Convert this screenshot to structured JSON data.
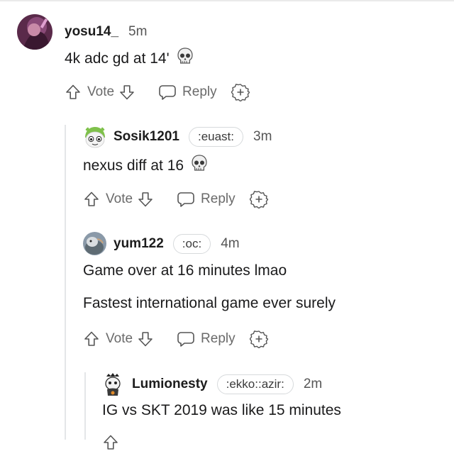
{
  "comments": [
    {
      "user": "yosu14_",
      "flair": "",
      "time": "5m",
      "lines": [
        "4k adc gd at 14'"
      ],
      "skull": true
    },
    {
      "user": "Sosik1201",
      "flair": ":euast:",
      "time": "3m",
      "lines": [
        "nexus diff at 16"
      ],
      "skull": true
    },
    {
      "user": "yum122",
      "flair": ":oc:",
      "time": "4m",
      "lines": [
        "Game over at 16 minutes lmao",
        "Fastest international game ever surely"
      ],
      "skull": false
    },
    {
      "user": "Lumionesty",
      "flair": ":ekko::azir:",
      "time": "2m",
      "lines": [
        "IG vs SKT 2019 was like 15 minutes"
      ],
      "skull": false
    }
  ],
  "actions": {
    "vote": "Vote",
    "reply": "Reply"
  },
  "icons": {
    "more": "more-options-icon",
    "upvote": "upvote-arrow-icon",
    "downvote": "downvote-arrow-icon",
    "reply": "speech-bubble-icon",
    "award": "add-award-icon",
    "skull": "skull-emoji-icon"
  },
  "colors": {
    "text": "#1a1a1b",
    "muted": "#6a6a6a",
    "thread": "#e4e6e8",
    "flair_border": "#d7dadc"
  }
}
